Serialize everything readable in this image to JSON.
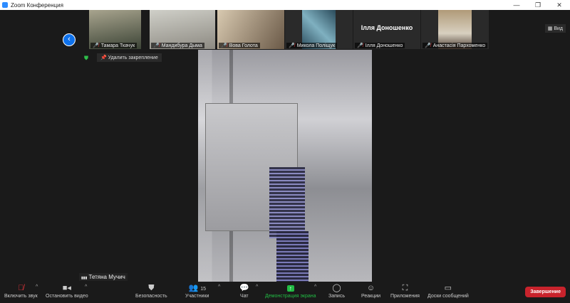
{
  "window": {
    "title": "Zoom Конференция",
    "minimize": "—",
    "restore": "❐",
    "close": "✕"
  },
  "participants_strip": [
    {
      "name": "Тамара Ткачук",
      "muted": true
    },
    {
      "name": "Мандибура Дыма",
      "muted": true
    },
    {
      "name": "Вова Голота",
      "muted": true
    },
    {
      "name": "Микола Поліщук",
      "muted": true
    },
    {
      "name": "Ілля Доношенко",
      "muted": true,
      "display_name": "Ілля Доношенко"
    },
    {
      "name": "Анастасія Пархоменко",
      "muted": true
    }
  ],
  "view_button": "▦ Вид",
  "back_icon": "‹",
  "pin": {
    "label": "Удалить закрепление",
    "icon": "📌"
  },
  "shield_icon": "⛊",
  "speaker": {
    "name": "Тетяна Мучич",
    "signal_icon": "▮▮▮"
  },
  "toolbar": {
    "unmute": "Включить звук",
    "stop_video": "Остановить видео",
    "security": "Безопасность",
    "participants": "Участники",
    "participants_count": "15",
    "chat": "Чат",
    "share": "Демонстрация экрана",
    "record": "Запись",
    "reactions": "Реакции",
    "apps": "Приложения",
    "whiteboards": "Доски сообщений",
    "end": "Завершение"
  },
  "colors": {
    "accent": "#0e71eb",
    "end": "#c8232c",
    "share": "#22bb44"
  }
}
